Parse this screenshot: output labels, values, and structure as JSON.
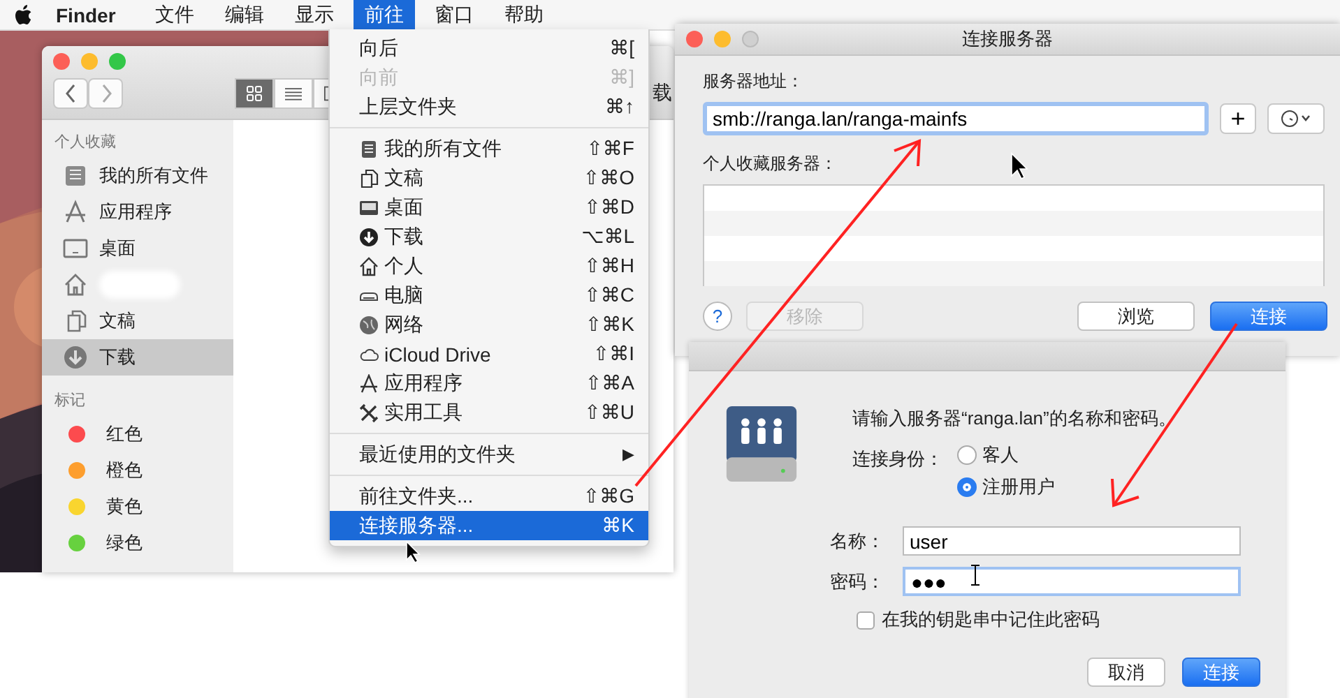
{
  "menu_bar": {
    "app_name": "Finder",
    "menus": [
      {
        "label": "文件",
        "selected": false
      },
      {
        "label": "编辑",
        "selected": false
      },
      {
        "label": "显示",
        "selected": false
      },
      {
        "label": "前往",
        "selected": true
      },
      {
        "label": "窗口",
        "selected": false
      },
      {
        "label": "帮助",
        "selected": false
      }
    ]
  },
  "finder": {
    "title_fragment": "载",
    "view_modes": [
      {
        "kind": "icons",
        "selected": true
      },
      {
        "kind": "list",
        "selected": false
      },
      {
        "kind": "columns",
        "selected": false
      }
    ],
    "sidebar": [
      {
        "heading": "个人收藏",
        "items": [
          {
            "kind": "all-files",
            "label": "我的所有文件",
            "selected": false
          },
          {
            "kind": "apps",
            "label": "应用程序",
            "selected": false
          },
          {
            "kind": "desktop",
            "label": "桌面",
            "selected": false
          },
          {
            "kind": "home",
            "selected": false
          },
          {
            "kind": "documents",
            "label": "文稿",
            "selected": false
          },
          {
            "kind": "downloads",
            "label": "下载",
            "selected": true
          }
        ]
      },
      {
        "heading": "标记",
        "items": [
          {
            "kind": "tag",
            "label": "红色",
            "color": "#fc4b4e",
            "selected": false
          },
          {
            "kind": "tag",
            "label": "橙色",
            "color": "#fd9e2e",
            "selected": false
          },
          {
            "kind": "tag",
            "label": "黄色",
            "color": "#f9d52f",
            "selected": false
          },
          {
            "kind": "tag",
            "label": "绿色",
            "color": "#67d13f",
            "selected": false
          }
        ]
      }
    ]
  },
  "go_menu": {
    "items": [
      {
        "kind": "plain",
        "label": "向后",
        "shortcut": "⌘[",
        "disabled": false,
        "selected": false
      },
      {
        "kind": "plain",
        "label": "向前",
        "shortcut": "⌘]",
        "disabled": true,
        "selected": false
      },
      {
        "kind": "plain",
        "label": "上层文件夹",
        "shortcut": "⌘↑",
        "disabled": false,
        "selected": false
      },
      {
        "kind": "separator"
      },
      {
        "kind": "all-files",
        "label": "我的所有文件",
        "shortcut": "⇧⌘F",
        "disabled": false,
        "selected": false
      },
      {
        "kind": "documents",
        "label": "文稿",
        "shortcut": "⇧⌘O",
        "disabled": false,
        "selected": false
      },
      {
        "kind": "desktop",
        "label": "桌面",
        "shortcut": "⇧⌘D",
        "disabled": false,
        "selected": false
      },
      {
        "kind": "downloads",
        "label": "下载",
        "shortcut": "⌥⌘L",
        "disabled": false,
        "selected": false
      },
      {
        "kind": "home",
        "label": "个人",
        "shortcut": "⇧⌘H",
        "disabled": false,
        "selected": false
      },
      {
        "kind": "computer",
        "label": "电脑",
        "shortcut": "⇧⌘C",
        "disabled": false,
        "selected": false
      },
      {
        "kind": "network",
        "label": "网络",
        "shortcut": "⇧⌘K",
        "disabled": false,
        "selected": false
      },
      {
        "kind": "cloud",
        "label": "iCloud Drive",
        "shortcut": "⇧⌘I",
        "disabled": false,
        "selected": false
      },
      {
        "kind": "apps",
        "label": "应用程序",
        "shortcut": "⇧⌘A",
        "disabled": false,
        "selected": false
      },
      {
        "kind": "tools",
        "label": "实用工具",
        "shortcut": "⇧⌘U",
        "disabled": false,
        "selected": false
      },
      {
        "kind": "separator"
      },
      {
        "kind": "submenu",
        "label": "最近使用的文件夹",
        "arrow": "▶",
        "disabled": false,
        "selected": false
      },
      {
        "kind": "separator"
      },
      {
        "kind": "plain",
        "label": "前往文件夹...",
        "shortcut": "⇧⌘G",
        "disabled": false,
        "selected": false
      },
      {
        "kind": "plain",
        "label": "连接服务器...",
        "shortcut": "⌘K",
        "disabled": false,
        "selected": true
      }
    ]
  },
  "connect_dialog": {
    "title": "连接服务器",
    "address_label": "服务器地址：",
    "address": "smb://ranga.lan/ranga-mainfs",
    "add_button": "+",
    "favorites_label": "个人收藏服务器：",
    "help_button": "?",
    "buttons": [
      {
        "kind": "secondary",
        "label": "移除",
        "disabled": true
      },
      {
        "kind": "secondary",
        "label": "浏览",
        "disabled": false
      },
      {
        "kind": "primary",
        "label": "连接",
        "disabled": false
      }
    ]
  },
  "auth_dialog": {
    "message": "请输入服务器“ranga.lan”的名称和密码。",
    "connect_as_label": "连接身份：",
    "options": [
      {
        "label": "客人",
        "selected": false
      },
      {
        "label": "注册用户",
        "selected": true
      }
    ],
    "name_label": "名称：",
    "name": "user",
    "password_label": "密码：",
    "password": "●●●",
    "remember": {
      "label": "在我的钥匙串中记住此密码",
      "checked": false
    },
    "buttons": [
      {
        "kind": "secondary",
        "label": "取消"
      },
      {
        "kind": "primary",
        "label": "连接"
      }
    ]
  }
}
